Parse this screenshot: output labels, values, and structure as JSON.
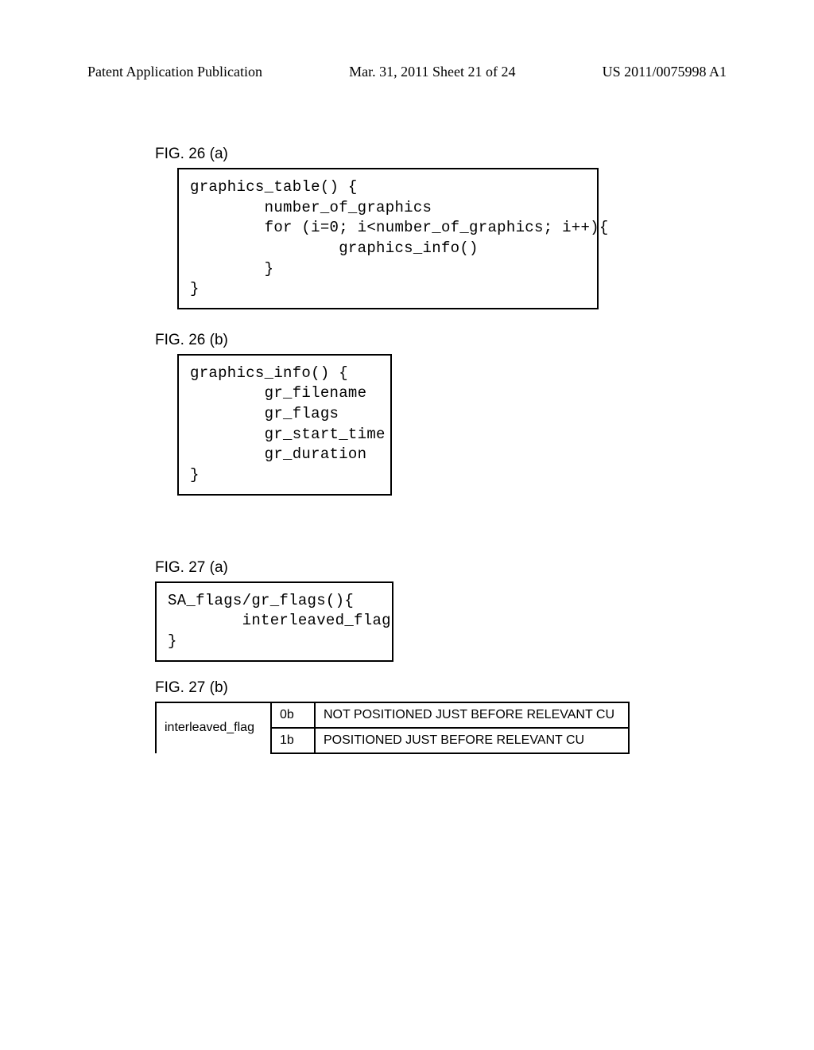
{
  "header": {
    "left": "Patent Application Publication",
    "center": "Mar. 31, 2011  Sheet 21 of 24",
    "right": "US 2011/0075998 A1"
  },
  "figures": {
    "f26a": {
      "label": "FIG. 26 (a)",
      "code": "graphics_table() {\n        number_of_graphics\n        for (i=0; i<number_of_graphics; i++){\n                graphics_info()\n        }\n}"
    },
    "f26b": {
      "label": "FIG. 26 (b)",
      "code": "graphics_info() {\n        gr_filename\n        gr_flags\n        gr_start_time\n        gr_duration\n}"
    },
    "f27a": {
      "label": "FIG. 27 (a)",
      "code": "SA_flags/gr_flags(){\n        interleaved_flag\n}"
    },
    "f27b": {
      "label": "FIG. 27 (b)",
      "table": {
        "field": "interleaved_flag",
        "rows": [
          {
            "value": "0b",
            "desc": "NOT POSITIONED JUST BEFORE RELEVANT CU"
          },
          {
            "value": "1b",
            "desc": "POSITIONED JUST BEFORE RELEVANT CU"
          }
        ]
      }
    }
  }
}
